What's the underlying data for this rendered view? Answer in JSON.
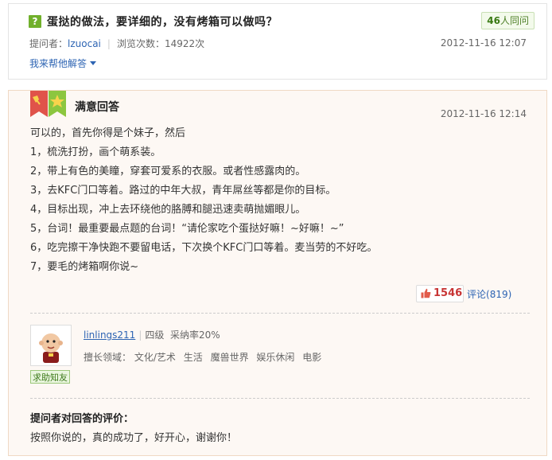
{
  "question": {
    "icon_label": "?",
    "title": "蛋挞的做法，要详细的，没有烤箱可以做吗？",
    "same_count": "46",
    "same_label": "人同问",
    "asker_label": "提问者：",
    "asker_name": "lzuocai",
    "separator": "|",
    "views_label": "浏览次数：14922次",
    "time": "2012-11-16 12:07",
    "help_link": "我来帮他解答"
  },
  "answer": {
    "badge_title": "满意回答",
    "time": "2012-11-16 12:14",
    "lines": [
      "可以的，首先你得是个妹子，然后",
      "1，梳洗打扮，画个萌系装。",
      "2，带上有色的美瞳，穿套可爱系的衣服。或者性感露肉的。",
      "3，去KFC门口等着。路过的中年大叔，青年屌丝等都是你的目标。",
      "4，目标出现，冲上去环绕他的胳膊和腿迅速卖萌抛媚眼儿。",
      "5，台词！最重要最点题的台词！“请伦家吃个蛋挞好嘛！~好嘛！~”",
      "6，吃完擦干净快跑不要留电话，下次换个KFC门口等着。麦当劳的不好吃。",
      "7，要毛的烤箱啊你说~"
    ],
    "likes": "1546",
    "comment_label": "评论",
    "comment_count": "(819)"
  },
  "answerer": {
    "name": "linlings211",
    "separator": "|",
    "level": "四级",
    "adopt_rate": "采纳率20%",
    "expert_label": "擅长领域：",
    "areas": [
      "文化/艺术",
      "生活",
      "魔兽世界",
      "娱乐休闲",
      "电影"
    ],
    "ask_friend": "求助知友"
  },
  "evaluation": {
    "title": "提问者对回答的评价：",
    "text": "按照你说的，真的成功了，好开心，谢谢你！"
  },
  "colors": {
    "accent_green": "#71b02c",
    "link_blue": "#2d64b3",
    "like_red": "#c83535"
  }
}
